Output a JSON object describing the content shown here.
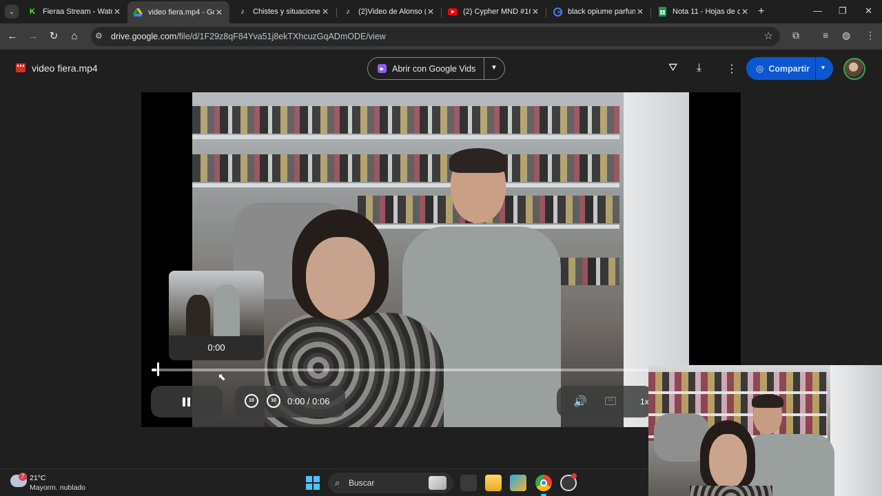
{
  "browser": {
    "tabs": [
      {
        "title": "Fieraa Stream - Wato",
        "icon": "kick-icon",
        "active": false
      },
      {
        "title": "video fiera.mp4 - Go",
        "icon": "google-drive-icon",
        "active": true
      },
      {
        "title": "Chistes y situaciones",
        "icon": "tiktok-icon",
        "active": false
      },
      {
        "title": "(2)Video de Alonso (",
        "icon": "tiktok-icon",
        "active": false
      },
      {
        "title": "(2) Cypher MND #16",
        "icon": "youtube-icon",
        "active": false
      },
      {
        "title": "black opiume parfun",
        "icon": "google-icon",
        "active": false
      },
      {
        "title": "Nota 11 - Hojas de c",
        "icon": "google-sheets-icon",
        "active": false
      }
    ],
    "url_host": "drive.google.com",
    "url_path": "/file/d/1F29z8qF84Yva51j8ekTXhcuzGqADmODE/view"
  },
  "drive": {
    "file_name": "video fiera.mp4",
    "open_with_label": "Abrir con Google Vids",
    "share_label": "Compartir"
  },
  "player": {
    "preview_time": "0:00",
    "time_label": "0:00 / 0:06",
    "progress_fraction": 0.01,
    "seek_back_label": "10",
    "seek_forward_label": "10",
    "speed_label": "1x",
    "cc_label": "CC"
  },
  "taskbar": {
    "weather_badge": "7",
    "temperature": "21°C",
    "condition": "Mayorm. nublado",
    "search_label": "Buscar"
  },
  "colors": {
    "share_button": "#0b57d0",
    "vids_icon": "#8e5cf7",
    "start_accent": "#4cc2ff"
  }
}
